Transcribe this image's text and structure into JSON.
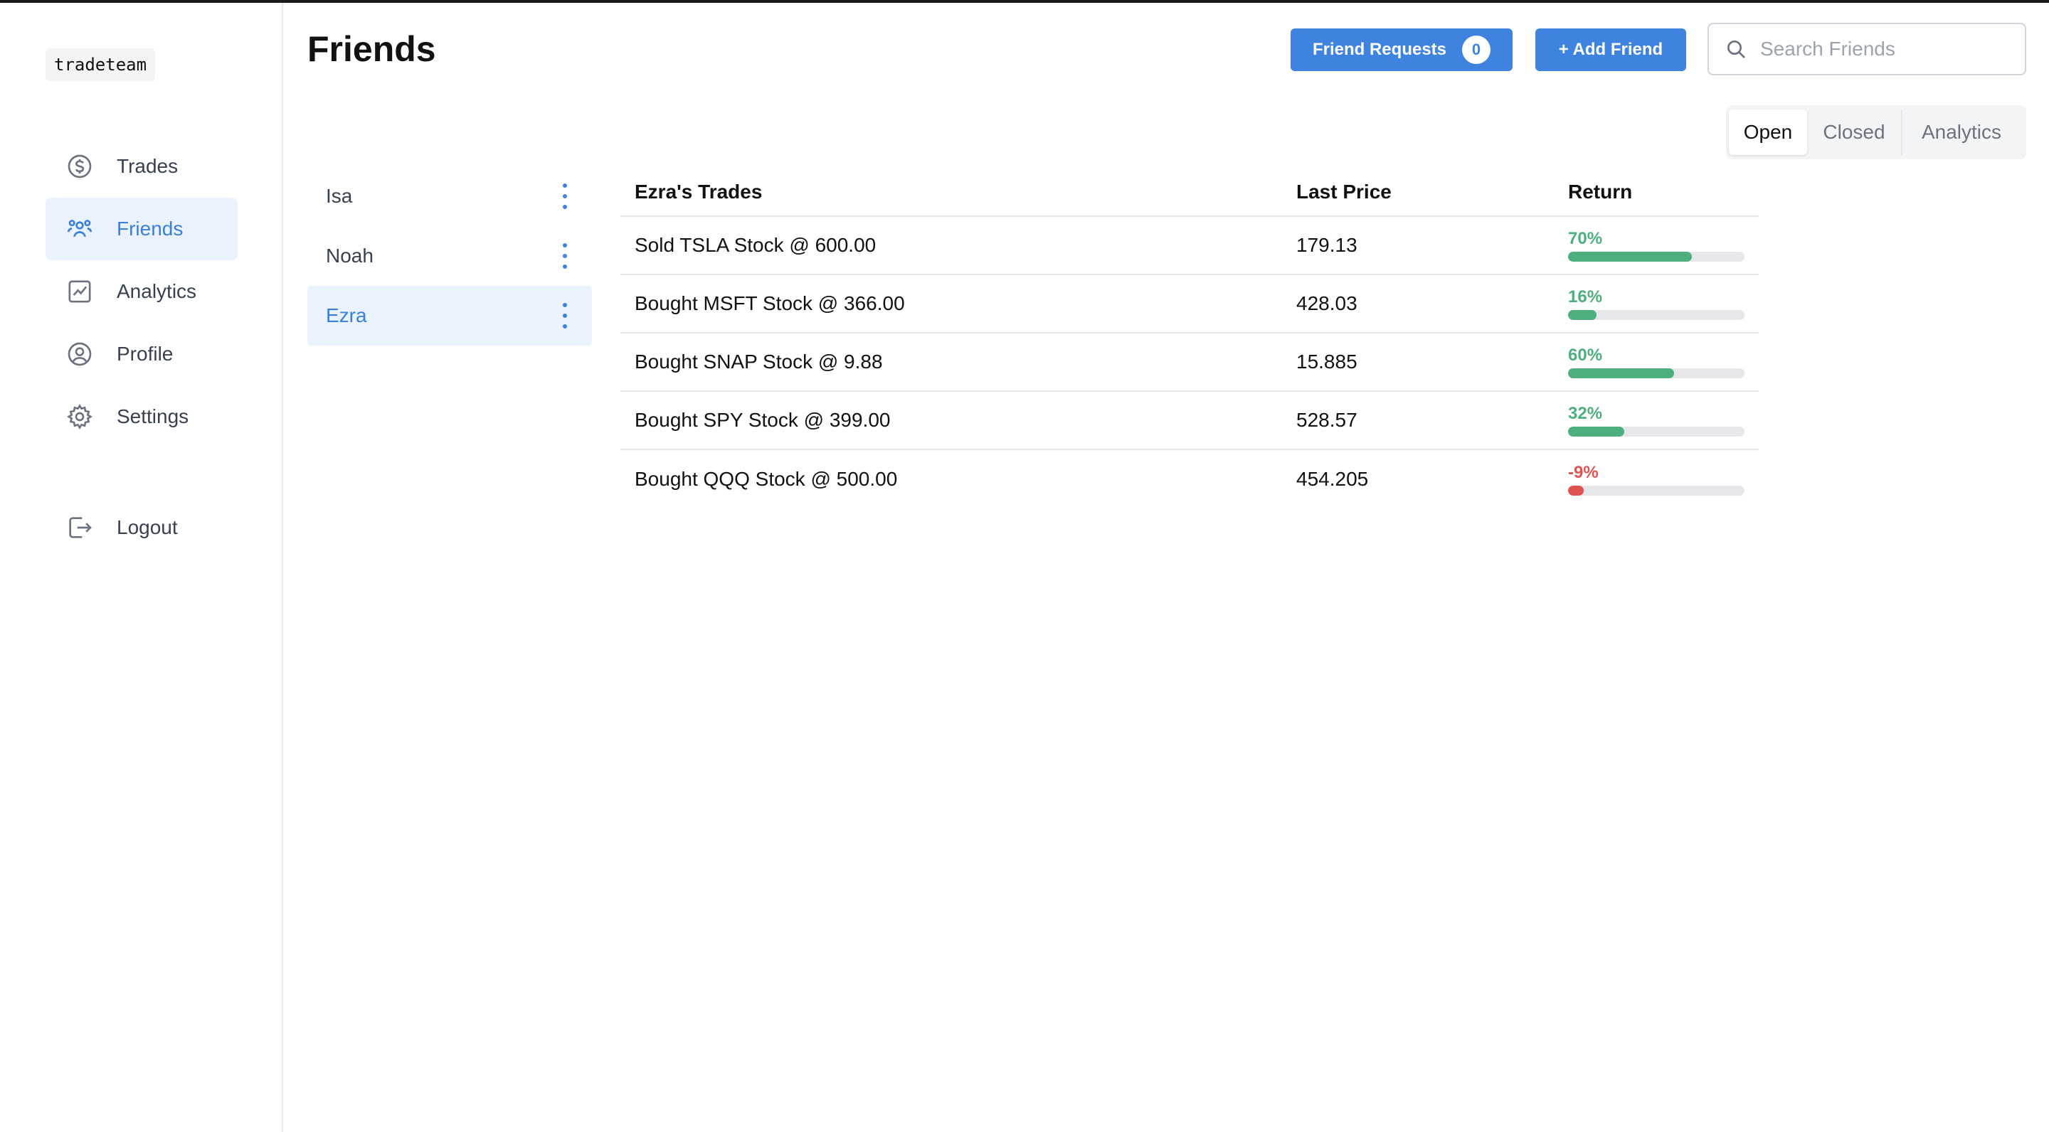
{
  "app": {
    "logo": "tradeteam"
  },
  "sidebar": {
    "items": [
      {
        "label": "Trades",
        "icon": "dollar-circle-icon"
      },
      {
        "label": "Friends",
        "icon": "users-icon",
        "active": true
      },
      {
        "label": "Analytics",
        "icon": "chart-line-icon"
      },
      {
        "label": "Profile",
        "icon": "user-circle-icon"
      },
      {
        "label": "Settings",
        "icon": "gear-icon"
      }
    ],
    "logout": {
      "label": "Logout",
      "icon": "logout-icon"
    }
  },
  "header": {
    "title": "Friends",
    "friend_requests_label": "Friend Requests",
    "friend_requests_count": "0",
    "add_friend_label": "+ Add Friend",
    "search_placeholder": "Search Friends"
  },
  "tabs": [
    "Open",
    "Closed",
    "Analytics"
  ],
  "friends": [
    {
      "name": "Isa"
    },
    {
      "name": "Noah"
    },
    {
      "name": "Ezra",
      "active": true
    }
  ],
  "trades_table": {
    "headers": [
      "Ezra's Trades",
      "Last Price",
      "Return"
    ],
    "rows": [
      {
        "trade": "Sold TSLA Stock @ 600.00",
        "last_price": "179.13",
        "return_label": "70%",
        "return_value": 70
      },
      {
        "trade": "Bought MSFT Stock @ 366.00",
        "last_price": "428.03",
        "return_label": "16%",
        "return_value": 16
      },
      {
        "trade": "Bought SNAP Stock @ 9.88",
        "last_price": "15.885",
        "return_label": "60%",
        "return_value": 60
      },
      {
        "trade": "Bought SPY Stock @ 399.00",
        "last_price": "528.57",
        "return_label": "32%",
        "return_value": 32
      },
      {
        "trade": "Bought QQQ Stock @ 500.00",
        "last_price": "454.205",
        "return_label": "-9%",
        "return_value": -9
      }
    ]
  },
  "colors": {
    "accent": "#3f83e0",
    "positive": "#4caf7d",
    "negative": "#e05252",
    "active_bg": "#eaf2fd"
  }
}
